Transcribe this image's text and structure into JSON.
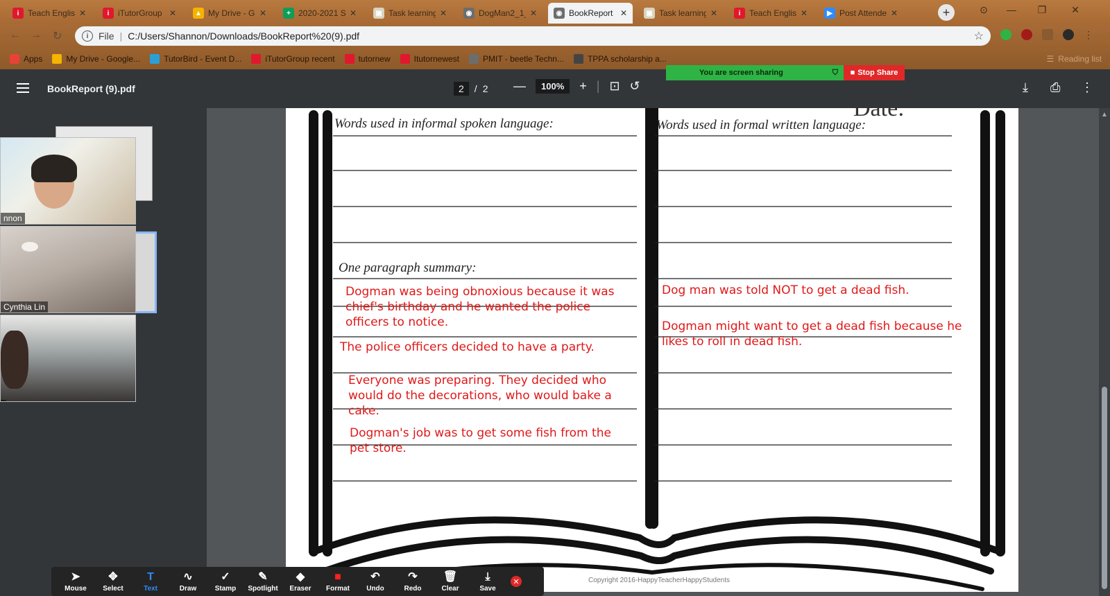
{
  "tabs": [
    {
      "label": "Teach English",
      "icon": "i",
      "color": "#e0182d"
    },
    {
      "label": "iTutorGroup",
      "icon": "i",
      "color": "#e0182d"
    },
    {
      "label": "My Drive - G",
      "icon": "▲",
      "color": "#f4b400"
    },
    {
      "label": "2020-2021 S",
      "icon": "+",
      "color": "#0f9d58"
    },
    {
      "label": "Task learning",
      "icon": "▣",
      "color": "#d9d4c0"
    },
    {
      "label": "DogMan2_1_",
      "icon": "◉",
      "color": "#6d6d6d"
    },
    {
      "label": "BookReport",
      "icon": "◉",
      "color": "#6d6d6d"
    },
    {
      "label": "Task learning",
      "icon": "▣",
      "color": "#d9d4c0"
    },
    {
      "label": "Teach English",
      "icon": "i",
      "color": "#e0182d"
    },
    {
      "label": "Post Attendee",
      "icon": "▶",
      "color": "#2d8cff"
    }
  ],
  "omnibox": {
    "scheme_label": "File",
    "url": "C:/Users/Shannon/Downloads/BookReport%20(9).pdf"
  },
  "bookmarks": [
    {
      "label": "Apps",
      "color": "#e94235"
    },
    {
      "label": "My Drive - Google...",
      "color": "#f4b400"
    },
    {
      "label": "TutorBird - Event D...",
      "color": "#2aa0d8"
    },
    {
      "label": "iTutorGroup recent",
      "color": "#e0182d"
    },
    {
      "label": "tutornew",
      "color": "#e0182d"
    },
    {
      "label": "Itutornewest",
      "color": "#e0182d"
    },
    {
      "label": "PMIT - beetle Techn...",
      "color": "#6d6d6d"
    },
    {
      "label": "TPPA scholarship a...",
      "color": "#444444"
    }
  ],
  "reading_list": "Reading list",
  "pdf": {
    "title": "BookReport (9).pdf",
    "page_current": "2",
    "page_sep": "/",
    "page_total": "2",
    "zoom": "100%"
  },
  "share": {
    "status": "You are screen sharing",
    "stop_label": "Stop Share"
  },
  "participants": [
    {
      "name": "nnon"
    },
    {
      "name": "Cynthia Lin"
    },
    {
      "name": ""
    }
  ],
  "worksheet": {
    "date_label": "Date:",
    "left_header": "Words used in informal spoken language:",
    "right_header": "Words used in formal written language:",
    "summary_header": "One paragraph summary:",
    "copyright": "Copyright 2016-HappyTeacherHappyStudents"
  },
  "annotations_left": [
    "Dogman was being obnoxious because it was chief's birthday and he wanted the police officers to notice.",
    "The police officers decided to have a party.",
    "Everyone was preparing. They decided who would do the decorations, who would bake a cake.",
    "Dogman's job was to get some fish from the pet store."
  ],
  "annotations_right": [
    "Dog man was told NOT to get a dead fish.",
    "Dogman might want to get a dead fish because he likes to roll in dead fish."
  ],
  "annotation_tools": [
    {
      "label": "Mouse",
      "icon": "➤"
    },
    {
      "label": "Select",
      "icon": "✥"
    },
    {
      "label": "Text",
      "icon": "T"
    },
    {
      "label": "Draw",
      "icon": "∿"
    },
    {
      "label": "Stamp",
      "icon": "✓"
    },
    {
      "label": "Spotlight",
      "icon": "✎"
    },
    {
      "label": "Eraser",
      "icon": "◆"
    },
    {
      "label": "Format",
      "icon": "■"
    },
    {
      "label": "Undo",
      "icon": "↶"
    },
    {
      "label": "Redo",
      "icon": "↷"
    },
    {
      "label": "Clear",
      "icon": "🗑"
    },
    {
      "label": "Save",
      "icon": "⤓"
    }
  ],
  "selected_tool": "Text",
  "format_color": "#ff2020"
}
